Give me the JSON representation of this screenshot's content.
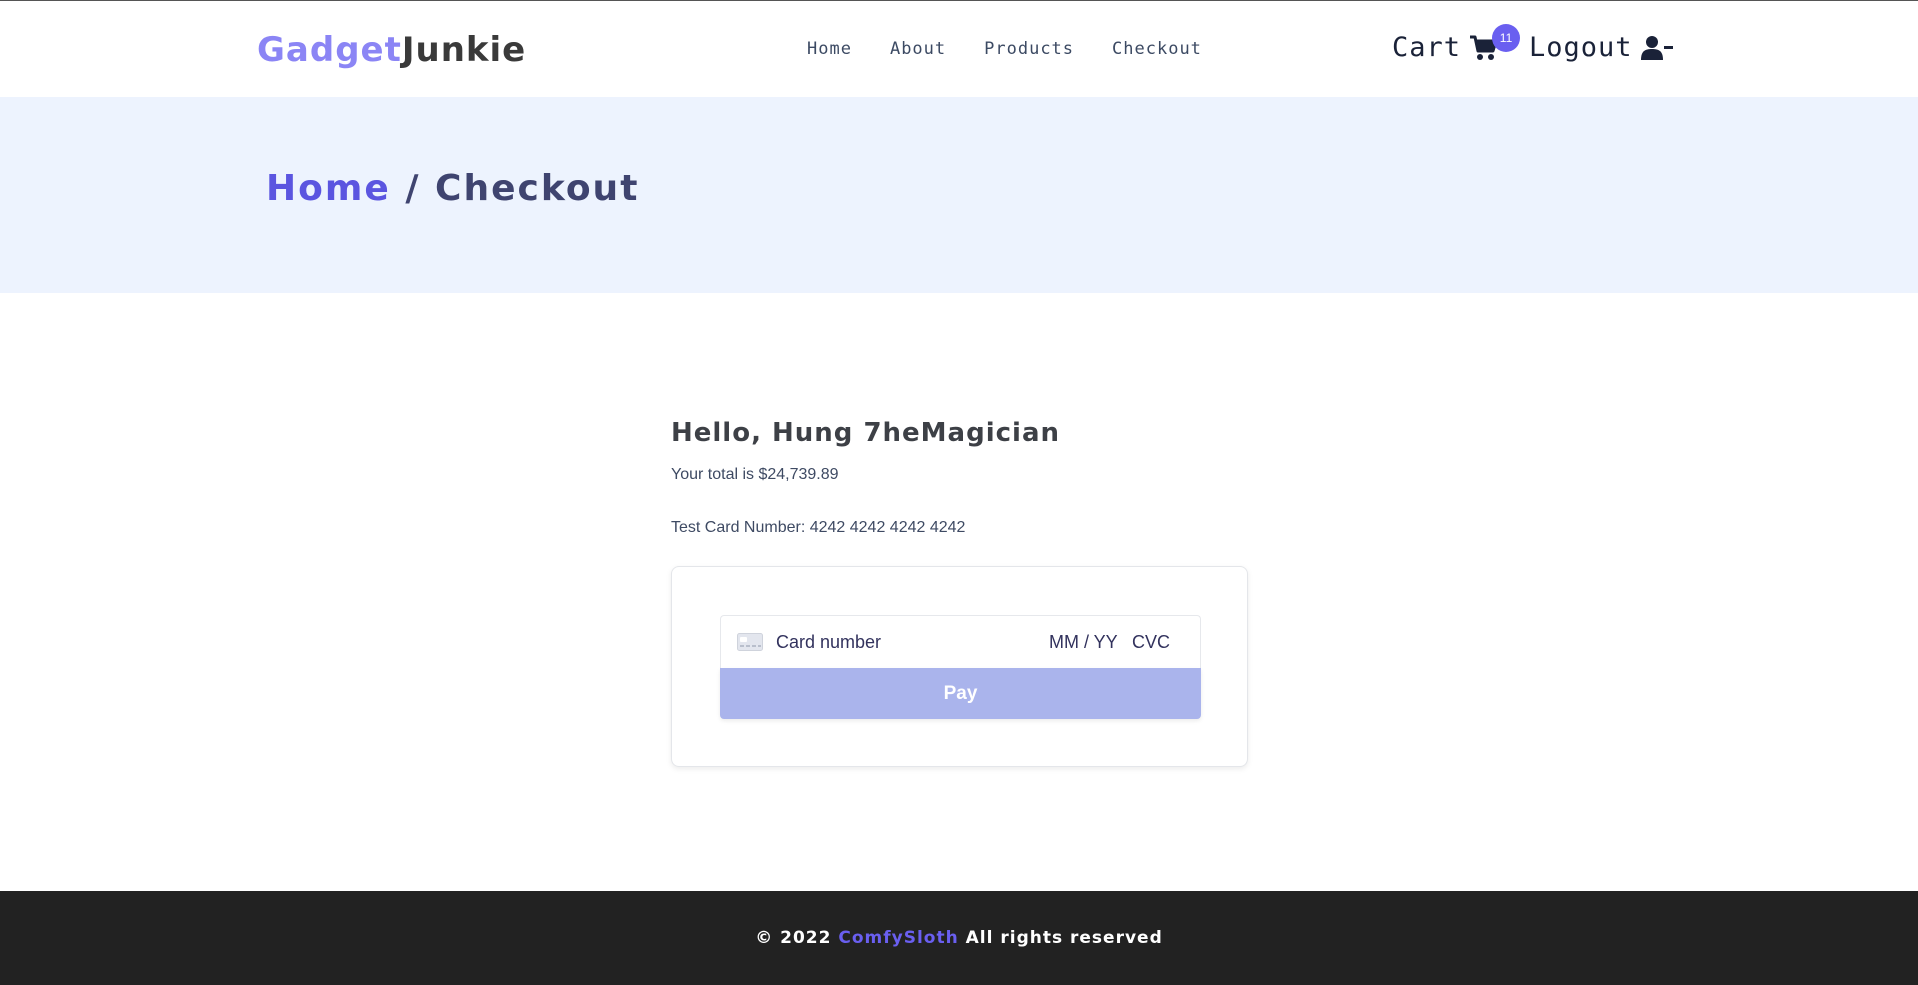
{
  "nav": {
    "logo_part1": "Gadget",
    "logo_part2": "Junkie",
    "links": [
      "Home",
      "About",
      "Products",
      "Checkout"
    ],
    "cart_label": "Cart",
    "cart_count": "11",
    "logout_label": "Logout"
  },
  "hero": {
    "home": "Home",
    "separator": "/",
    "current": "Checkout"
  },
  "checkout": {
    "greeting": "Hello, Hung 7heMagician",
    "total_text": "Your total is $24,739.89",
    "test_card_text": "Test Card Number: 4242 4242 4242 4242",
    "card_number_placeholder": "Card number",
    "expiry_placeholder": "MM / YY",
    "cvc_placeholder": "CVC",
    "pay_label": "Pay"
  },
  "footer": {
    "copyright": "© 2022",
    "brand": "ComfySloth",
    "rights": "All rights reserved"
  },
  "colors": {
    "accent": "#6a5ff0",
    "hero_bg": "#edf3fe",
    "pay_button": "#aab4ec",
    "footer_bg": "#222222"
  },
  "icons": [
    "cart-icon",
    "user-minus-icon",
    "credit-card-icon"
  ]
}
